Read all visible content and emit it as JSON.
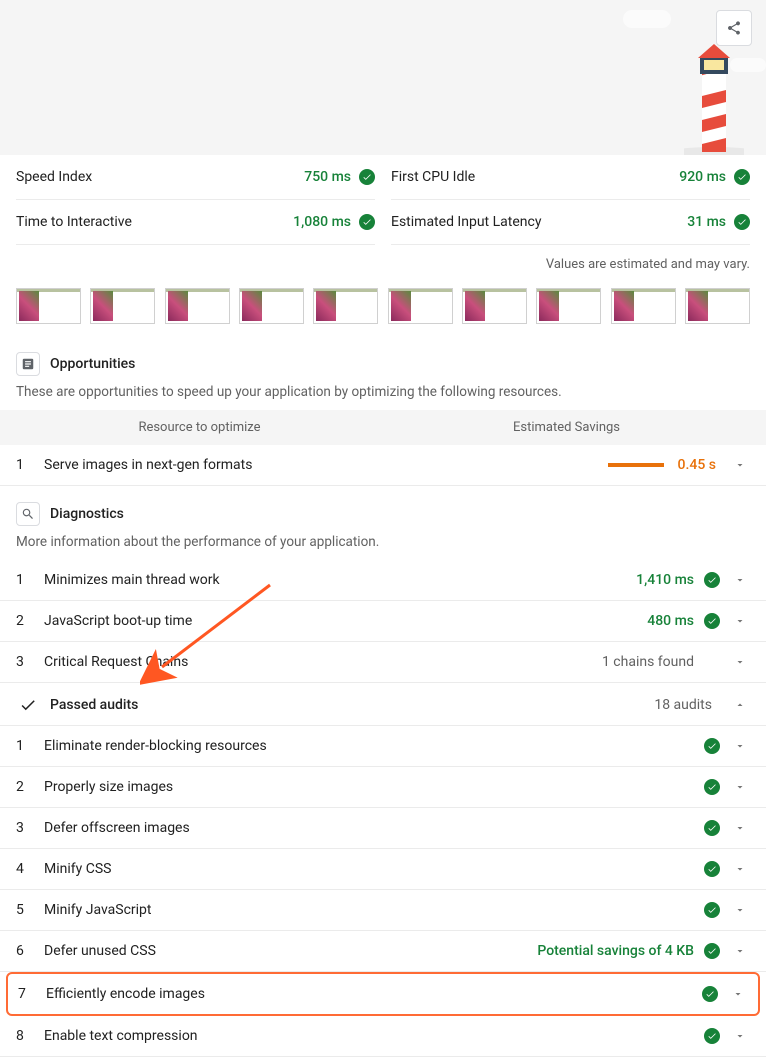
{
  "metrics": {
    "left": [
      {
        "label": "Speed Index",
        "value": "750 ms"
      },
      {
        "label": "Time to Interactive",
        "value": "1,080 ms"
      }
    ],
    "right": [
      {
        "label": "First CPU Idle",
        "value": "920 ms"
      },
      {
        "label": "Estimated Input Latency",
        "value": "31 ms"
      }
    ]
  },
  "estimate_note": "Values are estimated and may vary.",
  "opportunities": {
    "title": "Opportunities",
    "desc": "These are opportunities to speed up your application by optimizing the following resources.",
    "col1": "Resource to optimize",
    "col2": "Estimated Savings",
    "items": [
      {
        "num": "1",
        "label": "Serve images in next-gen formats",
        "value": "0.45 s"
      }
    ]
  },
  "diagnostics": {
    "title": "Diagnostics",
    "desc": "More information about the performance of your application.",
    "items": [
      {
        "num": "1",
        "label": "Minimizes main thread work",
        "value": "1,410 ms",
        "pass": true
      },
      {
        "num": "2",
        "label": "JavaScript boot-up time",
        "value": "480 ms",
        "pass": true
      },
      {
        "num": "3",
        "label": "Critical Request Chains",
        "value": "1 chains found",
        "pass": false
      }
    ]
  },
  "passed": {
    "title": "Passed audits",
    "count": "18 audits",
    "items": [
      {
        "num": "1",
        "label": "Eliminate render-blocking resources",
        "extra": ""
      },
      {
        "num": "2",
        "label": "Properly size images",
        "extra": ""
      },
      {
        "num": "3",
        "label": "Defer offscreen images",
        "extra": ""
      },
      {
        "num": "4",
        "label": "Minify CSS",
        "extra": ""
      },
      {
        "num": "5",
        "label": "Minify JavaScript",
        "extra": ""
      },
      {
        "num": "6",
        "label": "Defer unused CSS",
        "extra": "Potential savings of 4 KB"
      },
      {
        "num": "7",
        "label": "Efficiently encode images",
        "extra": "",
        "highlight": true
      },
      {
        "num": "8",
        "label": "Enable text compression",
        "extra": ""
      }
    ]
  }
}
